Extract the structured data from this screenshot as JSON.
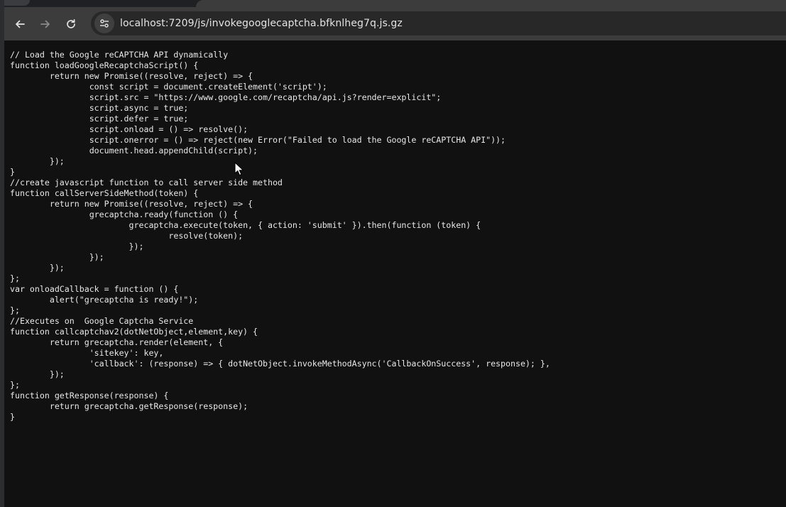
{
  "toolbar": {
    "back_icon": "arrow-left-icon",
    "forward_icon": "arrow-right-icon",
    "reload_icon": "reload-icon",
    "site_info_icon": "tune-icon",
    "url": "localhost:7209/js/invokegooglecaptcha.bfknlheg7q.js.gz"
  },
  "code_lines": [
    "// Load the Google reCAPTCHA API dynamically",
    "function loadGoogleRecaptchaScript() {",
    "\treturn new Promise((resolve, reject) => {",
    "\t\tconst script = document.createElement('script');",
    "\t\tscript.src = \"https://www.google.com/recaptcha/api.js?render=explicit\";",
    "\t\tscript.async = true;",
    "\t\tscript.defer = true;",
    "\t\tscript.onload = () => resolve();",
    "\t\tscript.onerror = () => reject(new Error(\"Failed to load the Google reCAPTCHA API\"));",
    "\t\tdocument.head.appendChild(script);",
    "\t});",
    "}",
    "//create javascript function to call server side method",
    "function callServerSideMethod(token) {",
    "\treturn new Promise((resolve, reject) => {",
    "\t\tgrecaptcha.ready(function () {",
    "\t\t\tgrecaptcha.execute(token, { action: 'submit' }).then(function (token) {",
    "\t\t\t\tresolve(token);",
    "\t\t\t});",
    "\t\t});",
    "\t});",
    "};",
    "var onloadCallback = function () {",
    "\talert(\"grecaptcha is ready!\");",
    "};",
    "//Executes on  Google Captcha Service",
    "function callcaptchav2(dotNetObject,element,key) {",
    "\treturn grecaptcha.render(element, {",
    "\t\t'sitekey': key,",
    "\t\t'callback': (response) => { dotNetObject.invokeMethodAsync('CallbackOnSuccess', response); },",
    "\t});",
    "};",
    "function getResponse(response) {",
    "\treturn grecaptcha.getResponse(response);",
    "}"
  ]
}
